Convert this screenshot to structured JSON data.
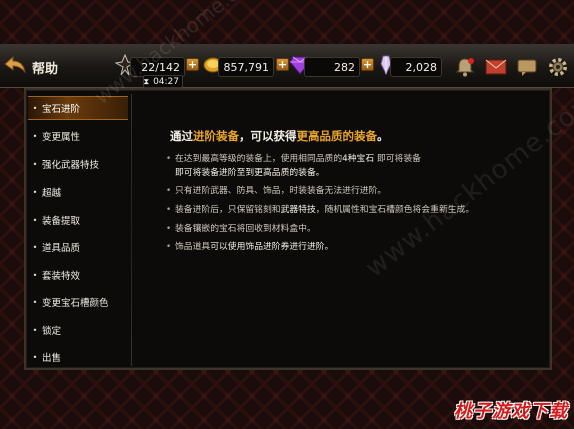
{
  "header": {
    "title": "帮助",
    "timer": "04:27"
  },
  "resources": {
    "stamina": "22/142",
    "gold": "857,791",
    "gems": "282",
    "crystals": "2,028"
  },
  "icons": {
    "back": "back-arrow-icon",
    "stamina": "stamina-icon",
    "gold": "gold-coin-icon",
    "gem": "purple-gem-icon",
    "crystal": "crystal-icon",
    "notification": "notification-icon",
    "mail": "mail-icon",
    "chat": "chat-icon",
    "settings": "gear-icon"
  },
  "sidebar": {
    "items": [
      {
        "label": "宝石进阶",
        "active": true
      },
      {
        "label": "变更属性"
      },
      {
        "label": "强化武器特技"
      },
      {
        "label": "超越"
      },
      {
        "label": "装备提取"
      },
      {
        "label": "道具品质"
      },
      {
        "label": "套装特效"
      },
      {
        "label": "变更宝石槽颜色"
      },
      {
        "label": "锁定"
      },
      {
        "label": "出售"
      }
    ]
  },
  "content": {
    "heading_pre": "通过",
    "heading_hl1": "进阶装备",
    "heading_mid": "，可以获得",
    "heading_hl2": "更高品质的装备",
    "heading_post": "。",
    "p1_a": "在达到最高等级的装备上，使用相同品质的",
    "p1_b": "4种宝石",
    "p1_c": " 即可将装备",
    "p1_line2": "即可将装备进阶至到更高品质的装备。",
    "p2": "只有进阶武器、防具、饰品，时装装备无法进行进阶。",
    "p3_a": "装备进阶后，只保留铭刻和",
    "p3_b": "武器特技",
    "p3_c": "，随机属性和宝石槽颜色将会重新生成。",
    "p4": "装备镶嵌的宝石将回收到材料盒中。",
    "p5_a": "饰品道具",
    "p5_b": "可以使用饰品进阶券进行进阶。"
  },
  "watermark": {
    "site": "www.hackhome.com",
    "corner": "桃子游戏下载"
  },
  "colors": {
    "accent": "#e8a42c",
    "active_tab": "#6a3c0e",
    "background": "#1a0c0a"
  }
}
